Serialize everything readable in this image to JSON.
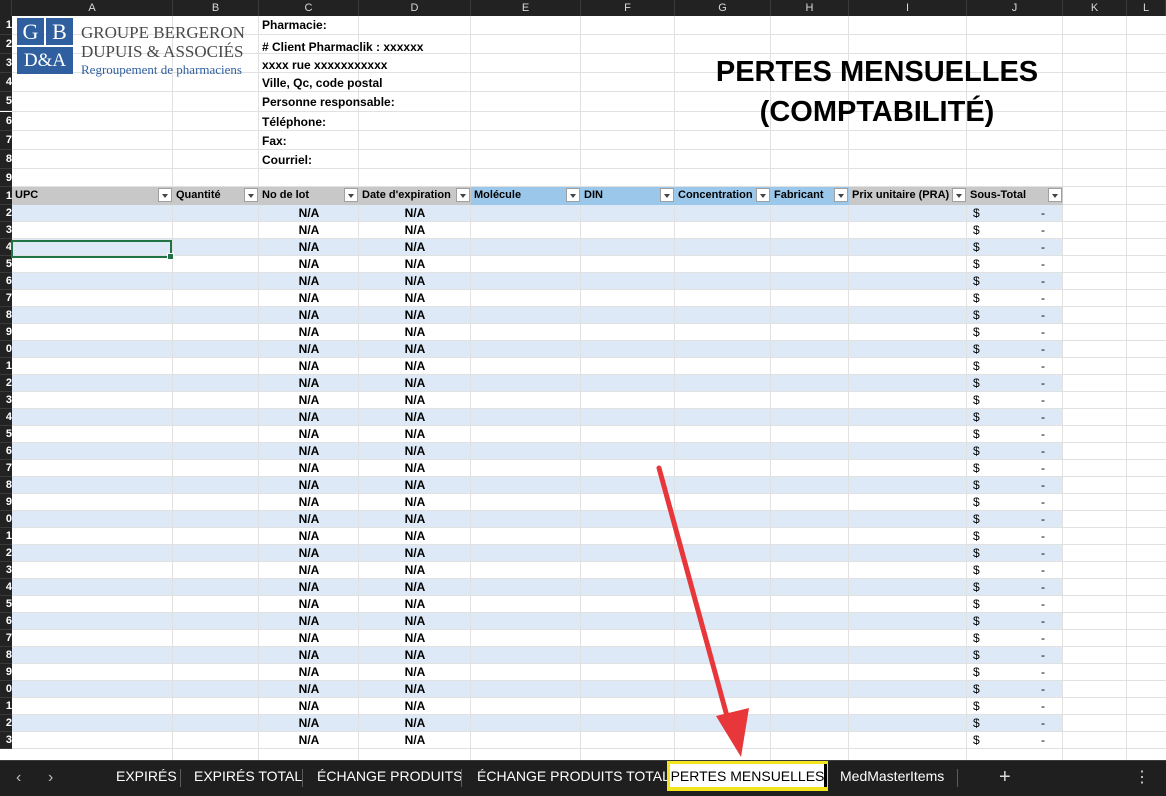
{
  "columns": [
    "A",
    "B",
    "C",
    "D",
    "E",
    "F",
    "G",
    "H",
    "I",
    "J",
    "K",
    "L"
  ],
  "logo": {
    "cells": [
      "G",
      "B",
      "D&A"
    ],
    "line1": "GROUPE BERGERON",
    "line2": "DUPUIS & ASSOCIÉS",
    "line3": "Regroupement de pharmaciens"
  },
  "info": {
    "pharmacie": "Pharmacie:",
    "client": "# Client Pharmaclik : xxxxxx",
    "rue": "xxxx rue xxxxxxxxxxx",
    "ville": "Ville, Qc, code postal",
    "responsable": "Personne responsable:",
    "telephone": "Téléphone:",
    "fax": "Fax:",
    "courriel": "Courriel:"
  },
  "title": {
    "line1": "PERTES MENSUELLES",
    "line2": "(COMPTABILITÉ)"
  },
  "table": {
    "headers": [
      "UPC",
      "Quantité",
      "No de lot",
      "Date d'expiration",
      "Molécule",
      "DIN",
      "Concentration",
      "Fabricant",
      "Prix unitaire (PRA)",
      "Sous-Total"
    ],
    "na_value": "N/A",
    "currency": "$",
    "dash": "-",
    "data_rows": 33
  },
  "row_numbers": [
    "1",
    "2",
    "3",
    "4",
    "5",
    "6",
    "7",
    "8",
    "9",
    "1",
    "2",
    "3",
    "4",
    "5",
    "6",
    "7",
    "8",
    "9",
    "0",
    "1",
    "2",
    "3",
    "4",
    "5",
    "6",
    "7",
    "8",
    "9",
    "0",
    "1",
    "2",
    "3",
    "4",
    "5",
    "6",
    "7",
    "8",
    "9",
    "0",
    "1",
    "2",
    "3"
  ],
  "colors": {
    "header_gray": "#c8c8c8",
    "header_blue": "#9bc8ea",
    "band": "#dde9f6",
    "active_tab_border": "#f2e51e"
  },
  "tabs": [
    "EXPIRÉS",
    "EXPIRÉS TOTAL",
    "ÉCHANGE PRODUITS",
    "ÉCHANGE PRODUITS TOTAL",
    "PERTES MENSUELLES",
    "MedMasterItems"
  ],
  "active_tab": "PERTES MENSUELLES",
  "icons": {
    "prev": "chevron-left-icon",
    "next": "chevron-right-icon",
    "add": "plus-icon",
    "more": "vertical-ellipsis-icon"
  }
}
